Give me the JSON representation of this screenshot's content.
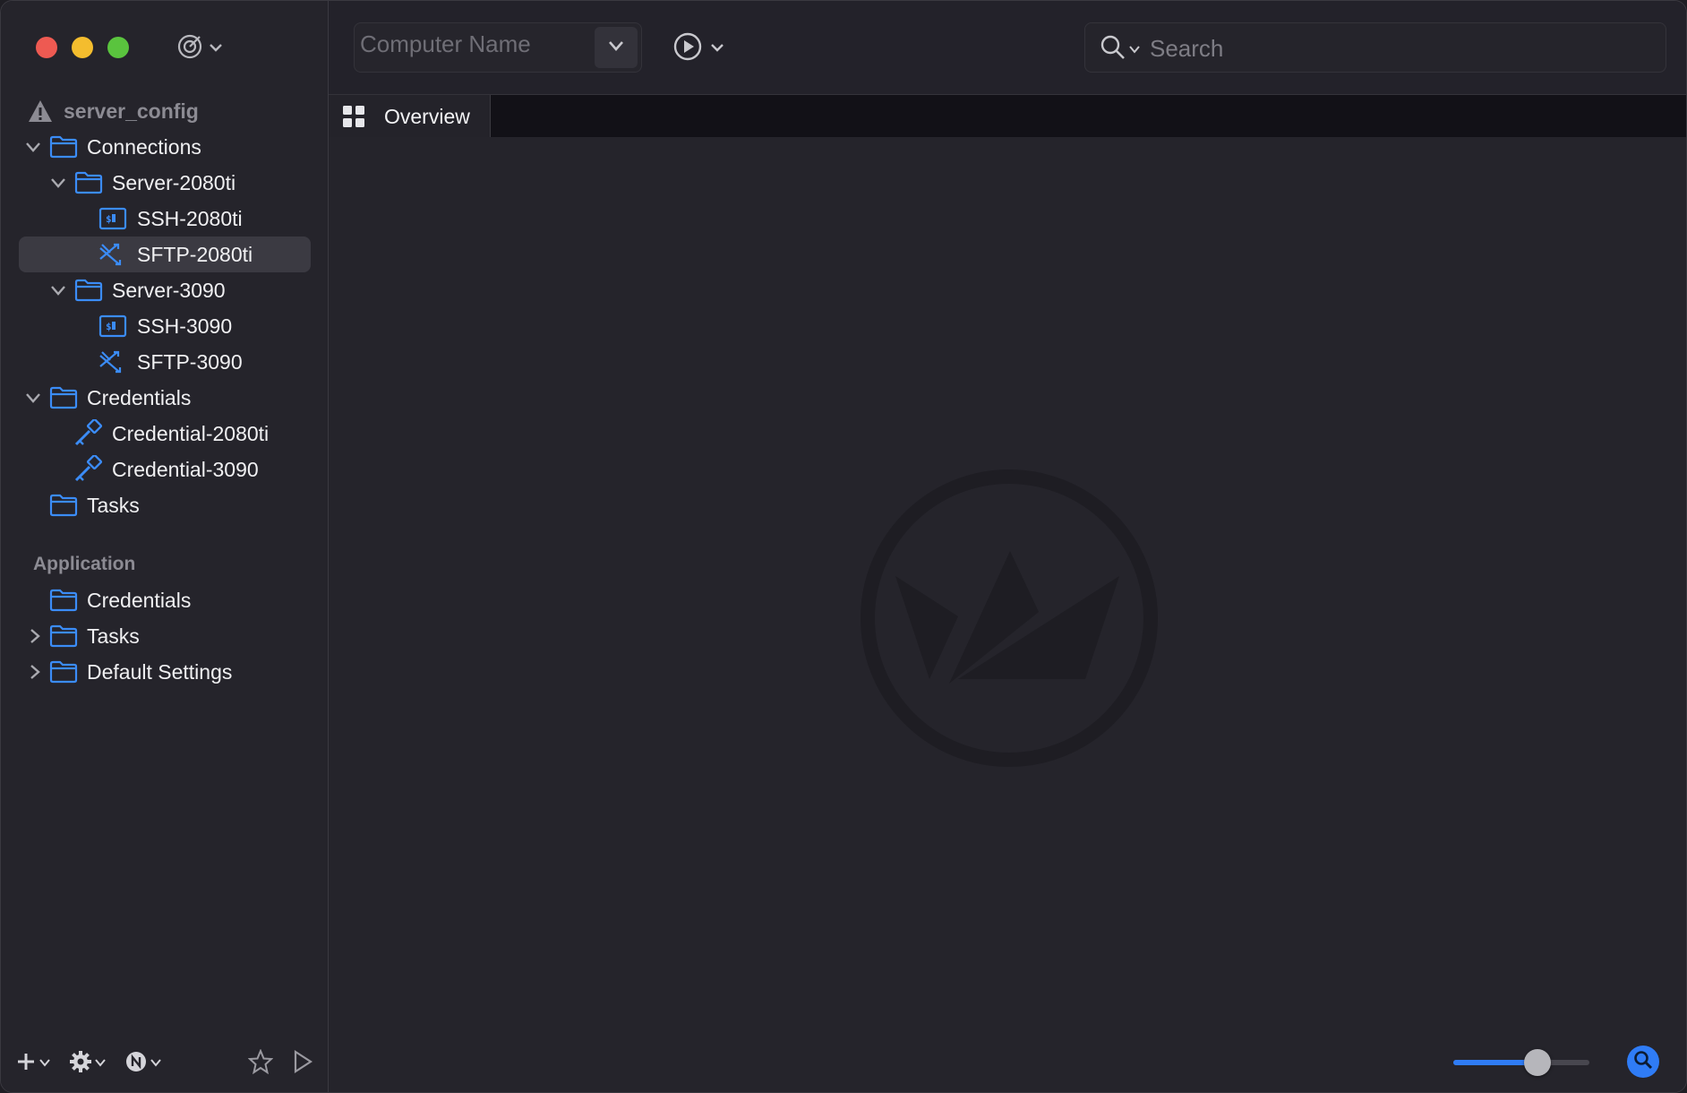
{
  "toolbar": {
    "computer_name_placeholder": "Computer Name",
    "search_placeholder": "Search"
  },
  "tabs": [
    {
      "label": "Overview"
    }
  ],
  "sidebar": {
    "root": "server_config",
    "tree": [
      {
        "label": "Connections",
        "icon": "folder-icon"
      },
      {
        "label": "Server-2080ti",
        "icon": "folder-icon"
      },
      {
        "label": "SSH-2080ti",
        "icon": "terminal-icon"
      },
      {
        "label": "SFTP-2080ti",
        "icon": "sftp-icon",
        "selected": true
      },
      {
        "label": "Server-3090",
        "icon": "folder-icon"
      },
      {
        "label": "SSH-3090",
        "icon": "terminal-icon"
      },
      {
        "label": "SFTP-3090",
        "icon": "sftp-icon"
      },
      {
        "label": "Credentials",
        "icon": "folder-icon"
      },
      {
        "label": "Credential-2080ti",
        "icon": "key-icon"
      },
      {
        "label": "Credential-3090",
        "icon": "key-icon"
      },
      {
        "label": "Tasks",
        "icon": "folder-icon"
      }
    ],
    "application_section": "Application",
    "application_items": [
      {
        "label": "Credentials",
        "icon": "folder-icon"
      },
      {
        "label": "Tasks",
        "icon": "folder-icon"
      },
      {
        "label": "Default Settings",
        "icon": "folder-icon"
      }
    ]
  },
  "zoom": {
    "level": 0.62
  },
  "colors": {
    "accent": "#2f7cf6",
    "folder": "#3b8cf7",
    "background": "#25242b"
  }
}
